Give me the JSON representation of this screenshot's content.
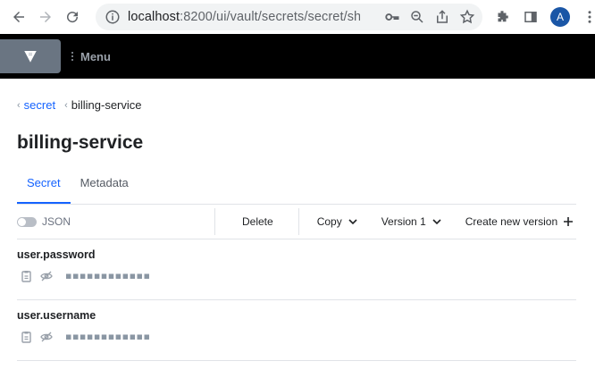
{
  "browser": {
    "url_host": "localhost",
    "url_path": ":8200/ui/vault/secrets/secret/sh...",
    "avatar_letter": "A"
  },
  "header": {
    "menu_label": "Menu"
  },
  "breadcrumb": {
    "parent": "secret",
    "current": "billing-service"
  },
  "page": {
    "title": "billing-service"
  },
  "tabs": [
    {
      "label": "Secret",
      "active": true
    },
    {
      "label": "Metadata",
      "active": false
    }
  ],
  "toolbar": {
    "json_label": "JSON",
    "delete_label": "Delete",
    "copy_label": "Copy",
    "version_label": "Version 1",
    "create_label": "Create new version"
  },
  "secrets": [
    {
      "key": "user.password",
      "masked": "▪▪▪▪▪▪▪▪▪▪▪▪"
    },
    {
      "key": "user.username",
      "masked": "▪▪▪▪▪▪▪▪▪▪▪▪"
    }
  ],
  "colors": {
    "accent": "#1563ff",
    "header_bg": "#000000"
  }
}
